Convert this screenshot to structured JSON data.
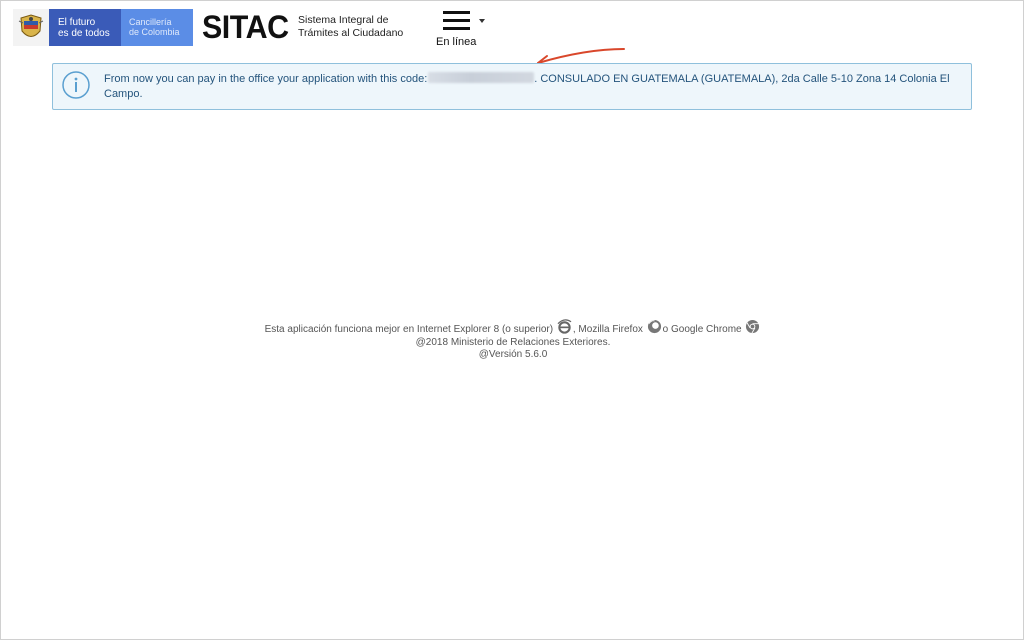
{
  "header": {
    "gov_logo": {
      "line1": "El futuro",
      "line2": "es de todos",
      "dept1": "Cancillería",
      "dept2": "de Colombia"
    },
    "brand": "SITAC",
    "brand_sub1": "Sistema Integral de",
    "brand_sub2": "Trámites al Ciudadano",
    "menu_label": "En línea"
  },
  "alert": {
    "text_before": "From now you can pay in the office your application with this code:",
    "text_after": ". CONSULADO EN GUATEMALA (GUATEMALA), 2da Calle 5-10 Zona 14 Colonia El Campo."
  },
  "footer": {
    "browsers_prefix": "Esta aplicación funciona mejor en Internet Explorer 8 (o superior)",
    "browsers_mid1": ", Mozilla Firefox",
    "browsers_mid2": "o Google Chrome",
    "copyright": "@2018 Ministerio de Relaciones Exteriores.",
    "version": "@Versión 5.6.0"
  },
  "colors": {
    "gov_dark": "#3a5bb8",
    "gov_light": "#5b8de6",
    "alert_border": "#8fc0dc",
    "alert_bg": "#eef6fb",
    "alert_text": "#24547c",
    "annotation_arrow": "#d9472b"
  },
  "icons": {
    "alert": "info-circle-icon",
    "menu": "hamburger-icon",
    "dropdown": "caret-down-icon",
    "ie": "internet-explorer-icon",
    "firefox": "firefox-icon",
    "chrome": "chrome-icon"
  }
}
